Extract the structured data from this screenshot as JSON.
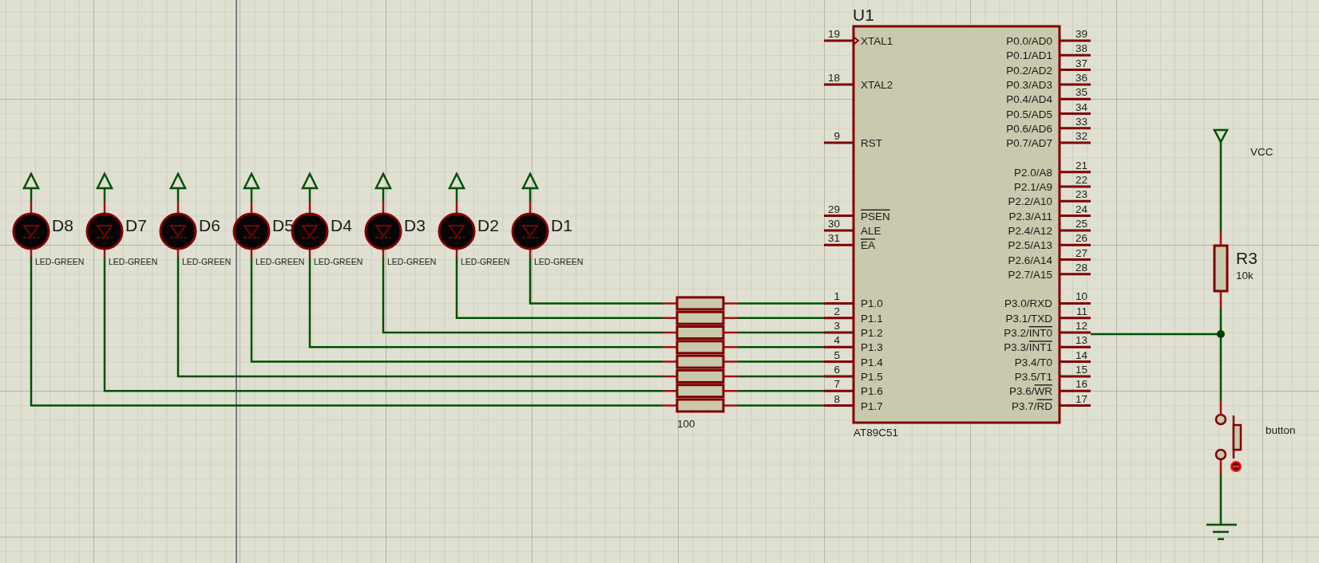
{
  "chip": {
    "ref": "U1",
    "part": "AT89C51",
    "left_groups": [
      [
        {
          "number": "19",
          "name": "XTAL1",
          "clock": true
        }
      ],
      [
        {
          "number": "18",
          "name": "XTAL2",
          "clock": false
        }
      ],
      [
        {
          "number": "9",
          "name": "RST",
          "clock": false
        }
      ],
      [
        {
          "number": "29",
          "inverted": "PSEN",
          "clock": false
        },
        {
          "number": "30",
          "name": "ALE",
          "clock": false
        },
        {
          "number": "31",
          "inverted": "EA",
          "clock": false
        }
      ],
      [
        {
          "number": "1",
          "name": "P1.0",
          "clock": false
        },
        {
          "number": "2",
          "name": "P1.1",
          "clock": false
        },
        {
          "number": "3",
          "name": "P1.2",
          "clock": false
        },
        {
          "number": "4",
          "name": "P1.3",
          "clock": false
        },
        {
          "number": "5",
          "name": "P1.4",
          "clock": false
        },
        {
          "number": "6",
          "name": "P1.5",
          "clock": false
        },
        {
          "number": "7",
          "name": "P1.6",
          "clock": false
        },
        {
          "number": "8",
          "name": "P1.7",
          "clock": false
        }
      ]
    ],
    "right_groups": [
      [
        {
          "number": "39",
          "name": "P0.0/AD0"
        },
        {
          "number": "38",
          "name": "P0.1/AD1"
        },
        {
          "number": "37",
          "name": "P0.2/AD2"
        },
        {
          "number": "36",
          "name": "P0.3/AD3"
        },
        {
          "number": "35",
          "name": "P0.4/AD4"
        },
        {
          "number": "34",
          "name": "P0.5/AD5"
        },
        {
          "number": "33",
          "name": "P0.6/AD6"
        },
        {
          "number": "32",
          "name": "P0.7/AD7"
        }
      ],
      [
        {
          "number": "21",
          "name": "P2.0/A8"
        },
        {
          "number": "22",
          "name": "P2.1/A9"
        },
        {
          "number": "23",
          "name": "P2.2/A10"
        },
        {
          "number": "24",
          "name": "P2.3/A11"
        },
        {
          "number": "25",
          "name": "P2.4/A12"
        },
        {
          "number": "26",
          "name": "P2.5/A13"
        },
        {
          "number": "27",
          "name": "P2.6/A14"
        },
        {
          "number": "28",
          "name": "P2.7/A15"
        }
      ],
      [
        {
          "number": "10",
          "name": "P3.0/RXD"
        },
        {
          "number": "11",
          "name": "P3.1/TXD"
        },
        {
          "number": "12",
          "name": "P3.2/",
          "inverted": "INT0"
        },
        {
          "number": "13",
          "name": "P3.3/",
          "inverted": "INT1"
        },
        {
          "number": "14",
          "name": "P3.4/T0"
        },
        {
          "number": "15",
          "name": "P3.5/T1"
        },
        {
          "number": "16",
          "name": "P3.6/",
          "inverted": "WR"
        },
        {
          "number": "17",
          "name": "P3.7/",
          "inverted": "RD"
        }
      ]
    ]
  },
  "leds": [
    {
      "ref": "D8",
      "value": "LED-GREEN"
    },
    {
      "ref": "D7",
      "value": "LED-GREEN"
    },
    {
      "ref": "D6",
      "value": "LED-GREEN"
    },
    {
      "ref": "D5",
      "value": "LED-GREEN"
    },
    {
      "ref": "D4",
      "value": "LED-GREEN"
    },
    {
      "ref": "D3",
      "value": "LED-GREEN"
    },
    {
      "ref": "D2",
      "value": "LED-GREEN"
    },
    {
      "ref": "D1",
      "value": "LED-GREEN"
    }
  ],
  "resistor_pack": {
    "value": "100"
  },
  "power": {
    "label": "VCC"
  },
  "pullup": {
    "ref": "R3",
    "value": "10k"
  },
  "switch": {
    "label": "button"
  }
}
